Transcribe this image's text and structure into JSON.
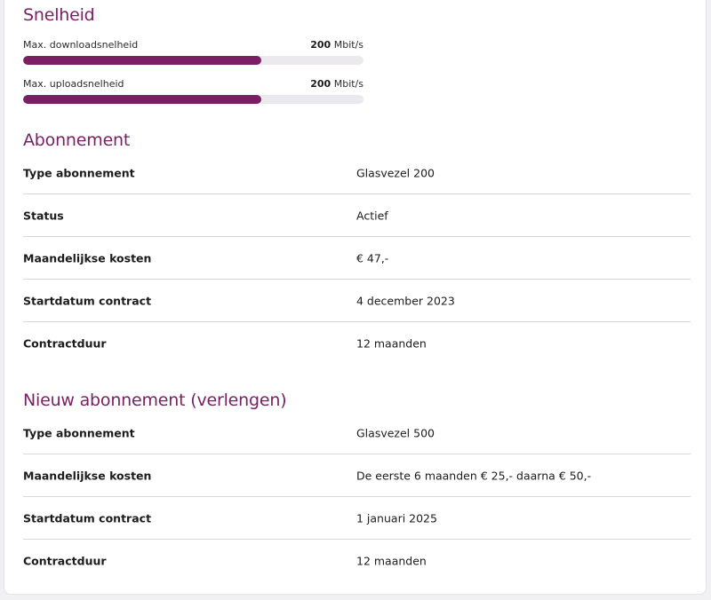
{
  "speed": {
    "title": "Snelheid",
    "download": {
      "label": "Max. downloadsnelheid",
      "value": "200",
      "unit": "Mbit/s",
      "fill": 0.7
    },
    "upload": {
      "label": "Max. uploadsnelheid",
      "value": "200",
      "unit": "Mbit/s",
      "fill": 0.7
    }
  },
  "subscription": {
    "title": "Abonnement",
    "rows": [
      {
        "label": "Type abonnement",
        "value": "Glasvezel 200"
      },
      {
        "label": "Status",
        "value": "Actief"
      },
      {
        "label": "Maandelijkse kosten",
        "value": "€ 47,-"
      },
      {
        "label": "Startdatum contract",
        "value": "4 december 2023"
      },
      {
        "label": "Contractduur",
        "value": "12 maanden"
      }
    ]
  },
  "renewal": {
    "title": "Nieuw abonnement (verlengen)",
    "rows": [
      {
        "label": "Type abonnement",
        "value": "Glasvezel 500"
      },
      {
        "label": "Maandelijkse kosten",
        "value": "De eerste 6 maanden € 25,- daarna € 50,-"
      },
      {
        "label": "Startdatum contract",
        "value": "1 januari 2025"
      },
      {
        "label": "Contractduur",
        "value": "12 maanden"
      }
    ]
  },
  "colors": {
    "accent": "#7a1f63",
    "track": "#ece9ee",
    "divider": "#d9d6dc"
  }
}
